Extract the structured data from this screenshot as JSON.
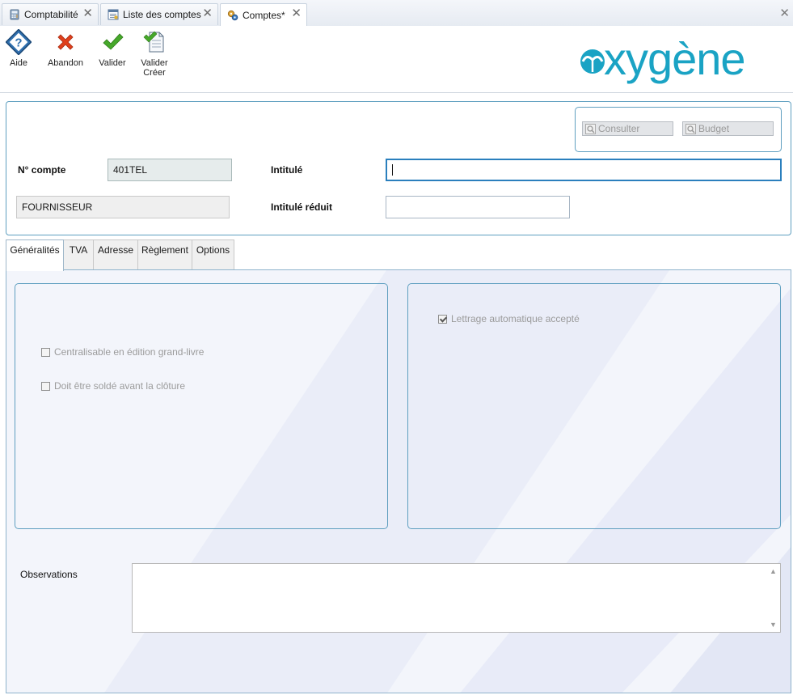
{
  "doc_tabs": [
    {
      "label": "Comptabilité"
    },
    {
      "label": "Liste des comptes"
    },
    {
      "label": "Comptes*"
    }
  ],
  "toolbar": {
    "help_label": "Aide",
    "abandon_label": "Abandon",
    "validate_label": "Valider",
    "validate_create_label_1": "Valider",
    "validate_create_label_2": "Créer"
  },
  "logo": {
    "text": "oxygène",
    "color": "#1aa3c4"
  },
  "header": {
    "consult_label": "Consulter",
    "budget_label": "Budget",
    "account_number_label": "N° compte",
    "account_number_value": "401TEL",
    "type_value": "FOURNISSEUR",
    "title_label": "Intitulé",
    "title_value": "",
    "short_title_label": "Intitulé réduit",
    "short_title_value": ""
  },
  "tabs": [
    {
      "label": "Généralités",
      "active": true
    },
    {
      "label": "TVA"
    },
    {
      "label": "Adresse"
    },
    {
      "label": "Règlement"
    },
    {
      "label": "Options"
    }
  ],
  "general": {
    "centralisable_label": "Centralisable en édition grand-livre",
    "centralisable_checked": false,
    "solde_label": "Doit être soldé avant la clôture",
    "solde_checked": false,
    "lettrage_label": "Lettrage automatique accepté",
    "lettrage_checked": true,
    "observations_label": "Observations",
    "observations_value": ""
  },
  "colors": {
    "accent_border": "#5f9fc0",
    "focus": "#2a7fbd",
    "validate_green": "#46a82a",
    "abandon_red": "#e0401c"
  }
}
